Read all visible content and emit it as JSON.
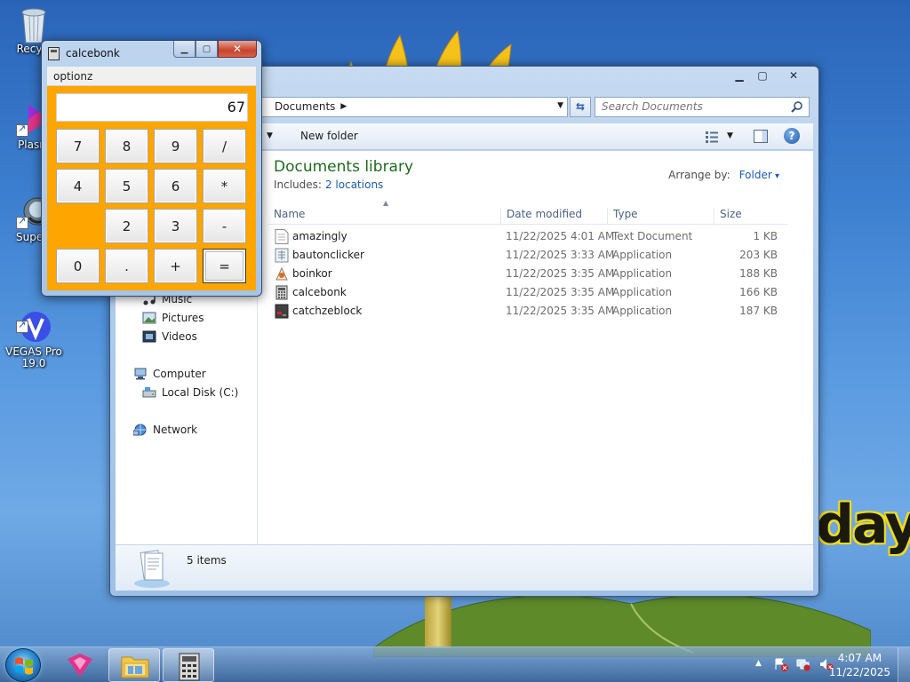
{
  "desktop": {
    "icons": [
      {
        "label": "Recycl"
      },
      {
        "label": "Plasm"
      },
      {
        "label": "Superr"
      },
      {
        "label": "VEGAS Pro\n19.0"
      }
    ],
    "wallpaper_text": "day"
  },
  "explorer": {
    "address": {
      "crumb": "Documents"
    },
    "search": {
      "placeholder": "Search Documents"
    },
    "toolbar": {
      "new_folder": "New folder"
    },
    "library": {
      "title": "Documents library",
      "includes_label": "Includes:",
      "includes_link": "2 locations",
      "arrange_label": "Arrange by:",
      "arrange_value": "Folder"
    },
    "columns": {
      "name": "Name",
      "date": "Date modified",
      "type": "Type",
      "size": "Size"
    },
    "files": [
      {
        "name": "amazingly",
        "date": "11/22/2025 4:01 AM",
        "type": "Text Document",
        "size": "1 KB",
        "icon": "text-file-icon"
      },
      {
        "name": "bautonclicker",
        "date": "11/22/2025 3:33 AM",
        "type": "Application",
        "size": "203 KB",
        "icon": "app-icon"
      },
      {
        "name": "boinkor",
        "date": "11/22/2025 3:35 AM",
        "type": "Application",
        "size": "188 KB",
        "icon": "app-icon"
      },
      {
        "name": "calcebonk",
        "date": "11/22/2025 3:35 AM",
        "type": "Application",
        "size": "166 KB",
        "icon": "calculator-icon"
      },
      {
        "name": "catchzeblock",
        "date": "11/22/2025 3:35 AM",
        "type": "Application",
        "size": "187 KB",
        "icon": "app-icon"
      }
    ],
    "nav": {
      "music": "Music",
      "pictures": "Pictures",
      "videos": "Videos",
      "computer": "Computer",
      "local_disk": "Local Disk (C:)",
      "network": "Network"
    },
    "status": {
      "items": "5 items"
    }
  },
  "calculator": {
    "title": "calcebonk",
    "menu": "optionz",
    "display": "67",
    "keys": {
      "k7": "7",
      "k8": "8",
      "k9": "9",
      "div": "/",
      "k4": "4",
      "k5": "5",
      "k6": "6",
      "mul": "*",
      "k2": "2",
      "k3": "3",
      "sub": "-",
      "k0": "0",
      "dot": ".",
      "add": "+",
      "eq": "="
    }
  },
  "taskbar": {
    "clock_time": "4:07 AM",
    "clock_date": "11/22/2025"
  },
  "colors": {
    "calc_body": "#ffa500",
    "library_title": "#1e6b1e",
    "link": "#1a5cb4"
  }
}
